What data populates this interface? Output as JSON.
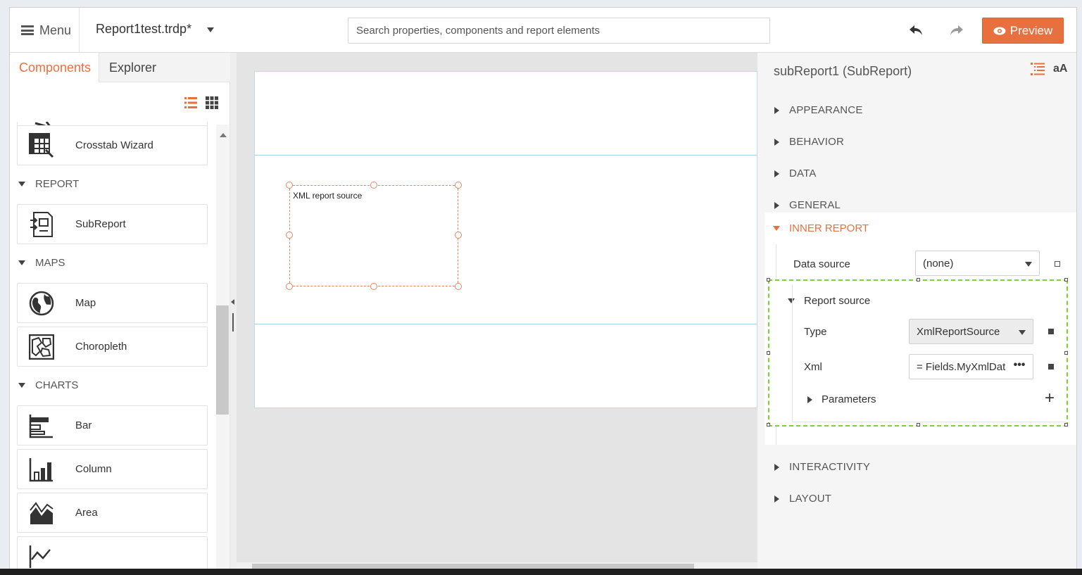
{
  "toolbar": {
    "menu_label": "Menu",
    "document_title": "Report1test.trdp*",
    "search_placeholder": "Search properties, components and report elements",
    "preview_label": "Preview"
  },
  "left_panel": {
    "tabs": [
      "Components",
      "Explorer"
    ],
    "active_tab": "Components",
    "items": {
      "crosstab_wizard": "Crosstab Wizard",
      "cat_report": "REPORT",
      "subreport": "SubReport",
      "cat_maps": "MAPS",
      "map": "Map",
      "choropleth": "Choropleth",
      "cat_charts": "CHARTS",
      "bar": "Bar",
      "column": "Column",
      "area": "Area"
    }
  },
  "canvas": {
    "subreport_text": "XML report source"
  },
  "properties": {
    "title": "subReport1 (SubReport)",
    "font_toggle": "aA",
    "sections": {
      "appearance": "APPEARANCE",
      "behavior": "BEHAVIOR",
      "data": "DATA",
      "general": "GENERAL",
      "inner_report": "INNER REPORT",
      "interactivity": "INTERACTIVITY",
      "layout": "LAYOUT"
    },
    "data_source_label": "Data source",
    "data_source_value": "(none)",
    "report_source_label": "Report source",
    "type_label": "Type",
    "type_value": "XmlReportSource",
    "xml_label": "Xml",
    "xml_value": "= Fields.MyXmlData",
    "xml_more": "•••",
    "parameters_label": "Parameters"
  },
  "colors": {
    "accent": "#e8703f",
    "selection_outline": "#7bd32f",
    "band_line": "#a9d0e3"
  }
}
